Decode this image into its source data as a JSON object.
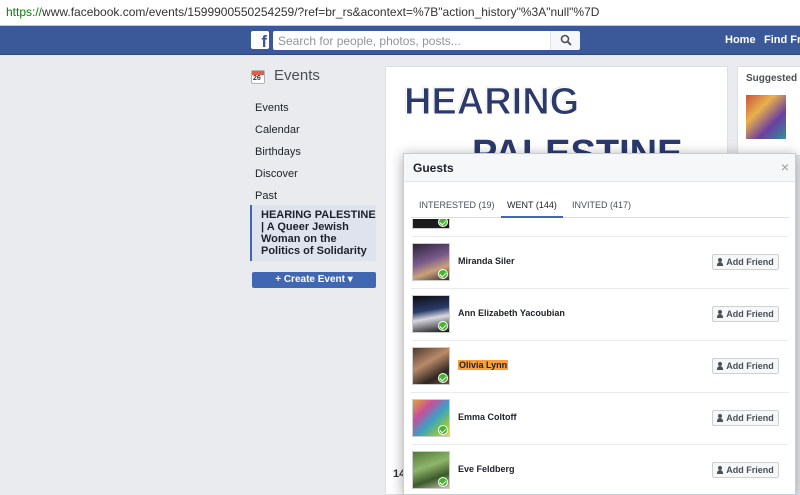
{
  "browser": {
    "url_protocol": "https://",
    "url_rest": "www.facebook.com/events/1599900550254259/?ref=br_rs&acontext=%7B\"action_history\"%3A\"null\"%7D"
  },
  "topnav": {
    "logo_letter": "f",
    "search_placeholder": "Search for people, photos, posts...",
    "home": "Home",
    "find_friends": "Find Frie"
  },
  "events_sidebar": {
    "title": "Events",
    "cal_day": "26",
    "items": [
      {
        "label": "Events"
      },
      {
        "label": "Calendar"
      },
      {
        "label": "Birthdays"
      },
      {
        "label": "Discover"
      },
      {
        "label": "Past"
      }
    ],
    "current_event": "HEARING PALESTINE | A Queer Jewish Woman on the Politics of Solidarity",
    "create_button": "+ Create Event ▾"
  },
  "event_cover": {
    "line1": "HEARING",
    "line2": "PALESTINE"
  },
  "right_rail": {
    "suggested": "Suggested Ev"
  },
  "background_count": "14",
  "modal": {
    "title": "Guests",
    "close": "×",
    "tabs": [
      {
        "label": "INTERESTED (19)"
      },
      {
        "label": "WENT (144)"
      },
      {
        "label": "INVITED (417)"
      }
    ],
    "add_friend_label": "Add Friend",
    "guests": [
      {
        "name": "Miranda Siler"
      },
      {
        "name": "Ann Elizabeth Yacoubian"
      },
      {
        "name": "Olivia Lynn"
      },
      {
        "name": "Emma Coltoff"
      },
      {
        "name": "Eve Feldberg"
      }
    ]
  }
}
